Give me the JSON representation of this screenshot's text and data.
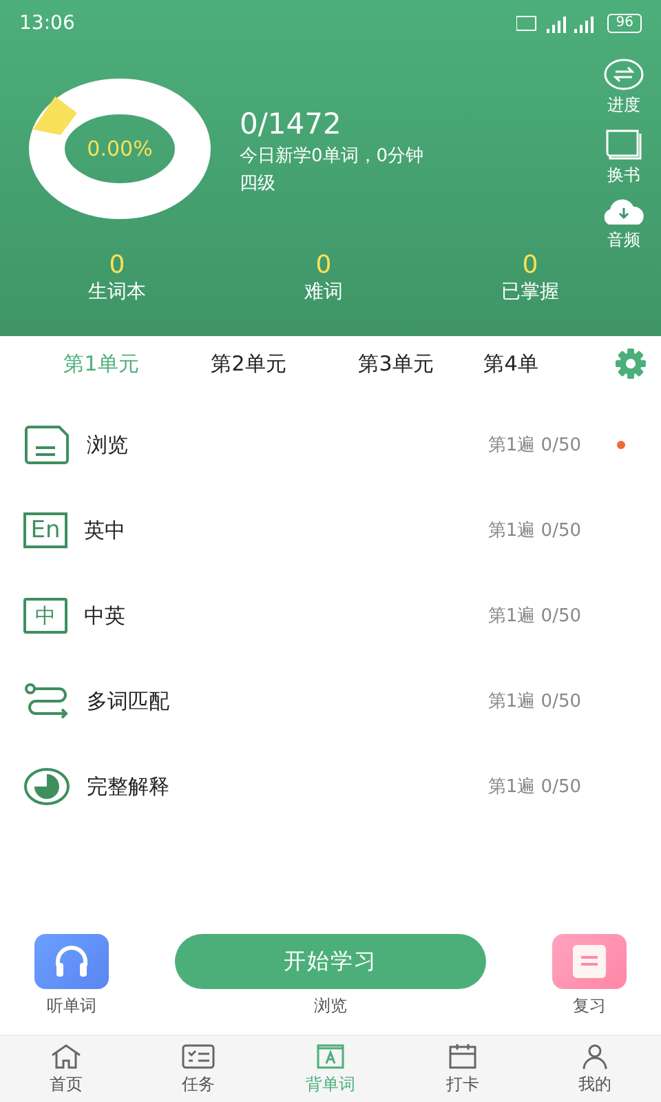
{
  "status_bar": {
    "time": "13:06",
    "battery": "96"
  },
  "progress": {
    "percent": "0.00%",
    "count": "0/1472",
    "today": "今日新学0单词，0分钟",
    "level_name": "四级"
  },
  "side_actions": [
    {
      "kind": "progress",
      "label": "进度"
    },
    {
      "kind": "book",
      "label": "换书"
    },
    {
      "kind": "audio",
      "label": "音频"
    }
  ],
  "stats": [
    {
      "value": "0",
      "label": "生词本"
    },
    {
      "value": "0",
      "label": "难词"
    },
    {
      "value": "0",
      "label": "已掌握"
    }
  ],
  "unit_tabs": [
    {
      "label": "第1单元",
      "selected": true
    },
    {
      "label": "第2单元",
      "selected": false
    },
    {
      "label": "第3单元",
      "selected": false
    },
    {
      "label": "第4单",
      "selected": false
    }
  ],
  "modes": [
    {
      "kind": "browse",
      "name": "浏览",
      "progress": "第1遍 0/50",
      "new": true
    },
    {
      "kind": "en",
      "icon_text": "En",
      "name": "英中",
      "progress": "第1遍 0/50",
      "new": false
    },
    {
      "kind": "zh",
      "icon_text": "中",
      "name": "中英",
      "progress": "第1遍 0/50",
      "new": false
    },
    {
      "kind": "match",
      "name": "多词匹配",
      "progress": "第1遍 0/50",
      "new": false
    },
    {
      "kind": "full",
      "name": "完整解释",
      "progress": "第1遍 0/50",
      "new": false
    }
  ],
  "actions": {
    "listen": "听单词",
    "start": "开始学习",
    "start_mode": "浏览",
    "review": "复习"
  },
  "nav": [
    {
      "kind": "home",
      "label": "首页",
      "selected": false
    },
    {
      "kind": "task",
      "label": "任务",
      "selected": false
    },
    {
      "kind": "words",
      "label": "背单词",
      "selected": true
    },
    {
      "kind": "checkin",
      "label": "打卡",
      "selected": false
    },
    {
      "kind": "me",
      "label": "我的",
      "selected": false
    }
  ]
}
